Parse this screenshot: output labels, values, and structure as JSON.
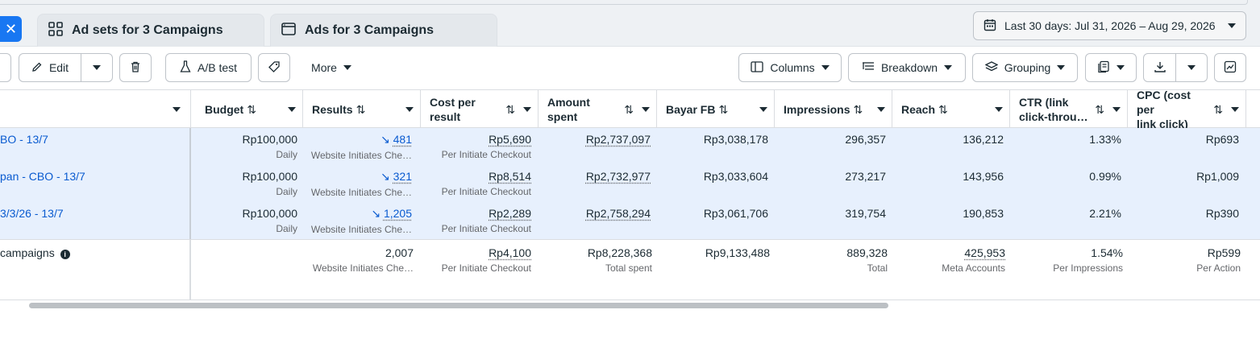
{
  "tabs": {
    "close_icon": "close-icon",
    "ad_sets_label": "Ad sets for 3 Campaigns",
    "ads_label": "Ads for 3 Campaigns"
  },
  "date_range": {
    "label": "Last 30 days: Jul 31, 2026 – Aug 29, 2026"
  },
  "toolbar": {
    "edit_label": "Edit",
    "ab_test_label": "A/B test",
    "more_label": "More",
    "columns_label": "Columns",
    "breakdown_label": "Breakdown",
    "grouping_label": "Grouping"
  },
  "columns": {
    "budget": "Budget",
    "results": "Results",
    "cost_per_result_1": "Cost per",
    "cost_per_result_2": "result",
    "amount_spent_1": "Amount",
    "amount_spent_2": "spent",
    "bayar_fb": "Bayar FB",
    "impressions": "Impressions",
    "reach": "Reach",
    "ctr_1": "CTR (link",
    "ctr_2": "click-throu…",
    "cpc_1": "CPC (cost per",
    "cpc_2": "link click)"
  },
  "rows": [
    {
      "name": "BO - 13/7",
      "budget": "Rp100,000",
      "budget_sub": "Daily",
      "results": "481",
      "results_sub": "Website Initiates Che…",
      "cpr": "Rp5,690",
      "cpr_sub": "Per Initiate Checkout",
      "amount": "Rp2,737,097",
      "bayar": "Rp3,038,178",
      "impressions": "296,357",
      "reach": "136,212",
      "ctr": "1.33%",
      "cpc": "Rp693"
    },
    {
      "name": "pan - CBO - 13/7",
      "budget": "Rp100,000",
      "budget_sub": "Daily",
      "results": "321",
      "results_sub": "Website Initiates Che…",
      "cpr": "Rp8,514",
      "cpr_sub": "Per Initiate Checkout",
      "amount": "Rp2,732,977",
      "bayar": "Rp3,033,604",
      "impressions": "273,217",
      "reach": "143,956",
      "ctr": "0.99%",
      "cpc": "Rp1,009"
    },
    {
      "name": "3/3/26 - 13/7",
      "budget": "Rp100,000",
      "budget_sub": "Daily",
      "results": "1,205",
      "results_sub": "Website Initiates Che…",
      "cpr": "Rp2,289",
      "cpr_sub": "Per Initiate Checkout",
      "amount": "Rp2,758,294",
      "bayar": "Rp3,061,706",
      "impressions": "319,754",
      "reach": "190,853",
      "ctr": "2.21%",
      "cpc": "Rp390"
    }
  ],
  "summary": {
    "name": "campaigns",
    "results": "2,007",
    "results_sub": "Website Initiates Che…",
    "cpr": "Rp4,100",
    "cpr_sub": "Per Initiate Checkout",
    "amount": "Rp8,228,368",
    "amount_sub": "Total spent",
    "bayar": "Rp9,133,488",
    "impressions": "889,328",
    "impressions_sub": "Total",
    "reach": "425,953",
    "reach_sub": "Meta Accounts",
    "ctr": "1.54%",
    "ctr_sub": "Per Impressions",
    "cpc": "Rp599",
    "cpc_sub": "Per Action"
  },
  "colors": {
    "accent": "#1877f2",
    "link": "#0a5bd0",
    "row_selected": "#e7f0fd"
  }
}
